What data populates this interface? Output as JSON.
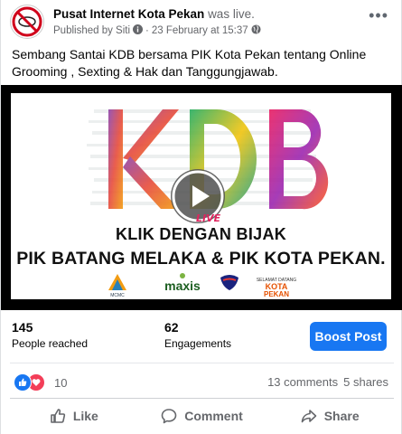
{
  "post": {
    "page_name": "Pusat Internet Kota Pekan",
    "action": "was live.",
    "published_by": "Published by Siti",
    "date": "23 February at 15:37",
    "separator": "·",
    "text": "Sembang Santai KDB bersama PIK Kota Pekan tentang Online Grooming , Sexting & Hak dan Tanggungjawab."
  },
  "media": {
    "logo_text": "KDB",
    "live_label": "LIVE",
    "tagline_1": "KLIK DENGAN BIJAK",
    "tagline_2": "PIK BATANG MELAKA & PIK KOTA PEKAN.",
    "partner_logos": [
      "MCMC",
      "maxis",
      "KOTA PEKAN"
    ]
  },
  "stats": {
    "reached_value": "145",
    "reached_label": "People reached",
    "engagements_value": "62",
    "engagements_label": "Engagements",
    "boost_label": "Boost Post"
  },
  "reactions": {
    "count": "10",
    "comments": "13 comments",
    "shares": "5 shares"
  },
  "actions": {
    "like": "Like",
    "comment": "Comment",
    "share": "Share"
  },
  "colors": {
    "accent": "#1877f2",
    "love": "#f33e58",
    "secondary_text": "#65676b"
  }
}
